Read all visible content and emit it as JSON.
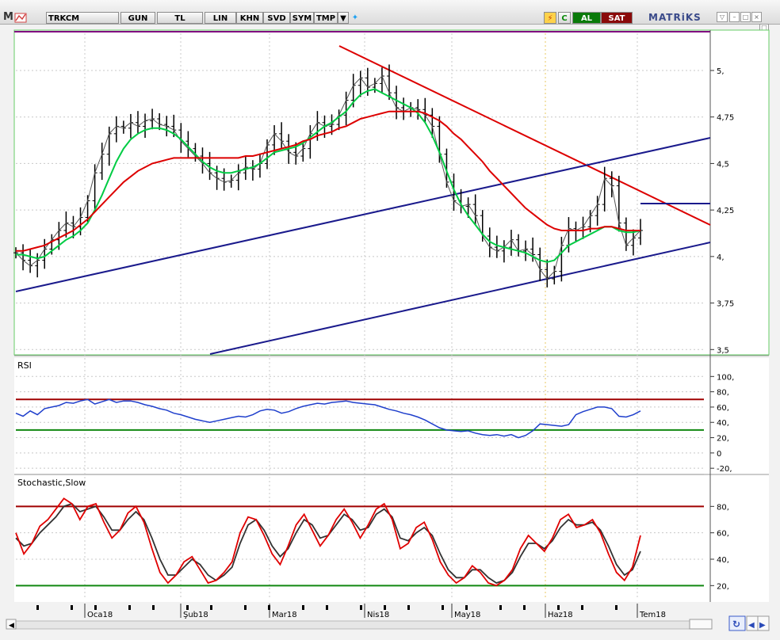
{
  "toolbar": {
    "symbol": "TRKCM",
    "period": "GUN",
    "currency": "TL",
    "scale": "LIN",
    "buttons": [
      "KHN",
      "SVD",
      "SYM",
      "TMP"
    ],
    "buy_label": "AL",
    "sell_label": "SAT",
    "brand": "MATRiKS"
  },
  "colors": {
    "background": "#ffffff",
    "price_bars": "#000000",
    "ma_fast": "#00cc44",
    "ma_slow": "#dd0000",
    "trend_red": "#dd0000",
    "channel_blue": "#1a1a8c",
    "rsi_line": "#1f3fcc",
    "stoch_k": "#e00000",
    "stoch_d": "#333333",
    "level_high": "#a00000",
    "level_low": "#118811",
    "panel_border": "#66cc66"
  },
  "chart_data": [
    {
      "type": "line",
      "panel": "price",
      "yticks": [
        "5,",
        "4,75",
        "4,5",
        "4,25",
        "4,",
        "3,75",
        "3,5"
      ],
      "ylim": [
        3.48,
        5.2
      ],
      "grid": true,
      "xticks": [
        "Oca18",
        "Şub18",
        "Mar18",
        "Nis18",
        "May18",
        "Haz18",
        "Tem18"
      ],
      "series": [
        {
          "values": [
            4.02,
            3.98,
            3.95,
            3.98,
            4.04,
            4.09,
            4.14,
            4.18,
            4.16,
            4.21,
            4.3,
            4.45,
            4.55,
            4.66,
            4.7,
            4.69,
            4.72,
            4.7,
            4.73,
            4.74,
            4.71,
            4.7,
            4.68,
            4.62,
            4.58,
            4.54,
            4.5,
            4.45,
            4.42,
            4.4,
            4.41,
            4.45,
            4.48,
            4.47,
            4.5,
            4.6,
            4.66,
            4.62,
            4.56,
            4.54,
            4.58,
            4.66,
            4.72,
            4.7,
            4.71,
            4.76,
            4.84,
            4.92,
            4.96,
            4.91,
            4.93,
            4.97,
            4.88,
            4.8,
            4.78,
            4.8,
            4.79,
            4.76,
            4.7,
            4.55,
            4.4,
            4.3,
            4.27,
            4.28,
            4.22,
            4.11,
            4.05,
            4.03,
            4.05,
            4.09,
            4.03,
            4.04,
            4.01,
            3.93,
            3.88,
            3.92,
            4.06,
            4.15,
            4.14,
            4.16,
            4.22,
            4.28,
            4.42,
            4.38,
            4.18,
            4.06,
            4.1,
            4.14
          ]
        },
        {
          "values": [
            4.01,
            4.01,
            4.0,
            3.99,
            4.0,
            4.03,
            4.06,
            4.09,
            4.11,
            4.14,
            4.18,
            4.25,
            4.33,
            4.42,
            4.51,
            4.58,
            4.63,
            4.66,
            4.68,
            4.69,
            4.69,
            4.68,
            4.66,
            4.63,
            4.59,
            4.55,
            4.51,
            4.48,
            4.46,
            4.45,
            4.45,
            4.46,
            4.47,
            4.48,
            4.5,
            4.53,
            4.56,
            4.57,
            4.58,
            4.59,
            4.61,
            4.64,
            4.67,
            4.7,
            4.72,
            4.75,
            4.78,
            4.83,
            4.87,
            4.89,
            4.9,
            4.88,
            4.86,
            4.84,
            4.82,
            4.8,
            4.77,
            4.72,
            4.65,
            4.56,
            4.46,
            4.36,
            4.28,
            4.22,
            4.17,
            4.12,
            4.08,
            4.06,
            4.05,
            4.04,
            4.03,
            4.02,
            4.0,
            3.98,
            3.97,
            3.98,
            4.02,
            4.06,
            4.08,
            4.1,
            4.12,
            4.14,
            4.16,
            4.16,
            4.14,
            4.13,
            4.13,
            4.14
          ]
        },
        {
          "values": [
            4.03,
            4.03,
            4.04,
            4.05,
            4.06,
            4.08,
            4.1,
            4.12,
            4.14,
            4.17,
            4.2,
            4.24,
            4.28,
            4.32,
            4.36,
            4.4,
            4.43,
            4.46,
            4.48,
            4.5,
            4.51,
            4.52,
            4.53,
            4.53,
            4.53,
            4.53,
            4.53,
            4.53,
            4.53,
            4.53,
            4.53,
            4.53,
            4.54,
            4.54,
            4.55,
            4.56,
            4.57,
            4.58,
            4.59,
            4.6,
            4.62,
            4.63,
            4.65,
            4.66,
            4.67,
            4.69,
            4.7,
            4.72,
            4.74,
            4.75,
            4.76,
            4.77,
            4.78,
            4.78,
            4.78,
            4.78,
            4.78,
            4.77,
            4.75,
            4.73,
            4.7,
            4.66,
            4.63,
            4.59,
            4.55,
            4.51,
            4.46,
            4.42,
            4.38,
            4.34,
            4.3,
            4.26,
            4.23,
            4.2,
            4.17,
            4.15,
            4.14,
            4.14,
            4.14,
            4.14,
            4.15,
            4.15,
            4.16,
            4.16,
            4.15,
            4.14,
            4.14,
            4.14
          ]
        }
      ]
    },
    {
      "type": "line",
      "panel": "RSI",
      "title": "RSI",
      "yticks": [
        "100,",
        "80,",
        "60,",
        "40,",
        "20,",
        "0",
        "-20,"
      ],
      "ylim": [
        -25,
        120
      ],
      "levels": [
        70,
        30
      ],
      "series": [
        {
          "values": [
            52,
            48,
            55,
            50,
            58,
            60,
            62,
            66,
            65,
            68,
            70,
            64,
            67,
            70,
            66,
            68,
            68,
            66,
            63,
            61,
            58,
            56,
            52,
            50,
            47,
            44,
            42,
            40,
            42,
            44,
            46,
            48,
            47,
            50,
            55,
            57,
            56,
            52,
            54,
            58,
            61,
            63,
            65,
            64,
            66,
            67,
            68,
            66,
            65,
            64,
            63,
            60,
            57,
            55,
            52,
            50,
            47,
            43,
            38,
            33,
            30,
            29,
            28,
            29,
            26,
            24,
            23,
            24,
            22,
            24,
            20,
            23,
            29,
            38,
            37,
            36,
            35,
            37,
            50,
            54,
            57,
            60,
            60,
            58,
            48,
            47,
            50,
            55
          ]
        }
      ]
    },
    {
      "type": "line",
      "panel": "stochastic",
      "title": "Stochastic,Slow",
      "yticks": [
        "80,",
        "60,",
        "40,",
        "20,"
      ],
      "ylim": [
        10,
        100
      ],
      "levels": [
        80,
        20
      ],
      "series": [
        {
          "values": [
            60,
            44,
            52,
            65,
            70,
            78,
            86,
            82,
            70,
            80,
            82,
            68,
            56,
            62,
            75,
            80,
            68,
            48,
            30,
            22,
            28,
            38,
            42,
            32,
            22,
            24,
            30,
            38,
            60,
            72,
            70,
            58,
            44,
            36,
            50,
            66,
            74,
            62,
            50,
            58,
            70,
            78,
            68,
            56,
            66,
            78,
            82,
            70,
            48,
            52,
            64,
            68,
            55,
            38,
            28,
            22,
            26,
            35,
            30,
            22,
            20,
            24,
            32,
            48,
            58,
            52,
            46,
            56,
            70,
            74,
            64,
            66,
            70,
            60,
            44,
            30,
            24,
            34,
            58
          ]
        },
        {
          "values": [
            56,
            50,
            52,
            60,
            66,
            72,
            80,
            82,
            76,
            78,
            80,
            72,
            62,
            62,
            70,
            76,
            70,
            56,
            40,
            28,
            28,
            34,
            40,
            36,
            28,
            24,
            28,
            34,
            52,
            66,
            70,
            62,
            50,
            42,
            48,
            60,
            70,
            66,
            56,
            58,
            66,
            74,
            70,
            62,
            64,
            74,
            78,
            72,
            56,
            54,
            60,
            64,
            58,
            44,
            32,
            26,
            26,
            32,
            32,
            26,
            22,
            24,
            30,
            42,
            52,
            52,
            48,
            54,
            64,
            70,
            66,
            66,
            68,
            62,
            50,
            36,
            28,
            32,
            46
          ]
        }
      ]
    }
  ]
}
